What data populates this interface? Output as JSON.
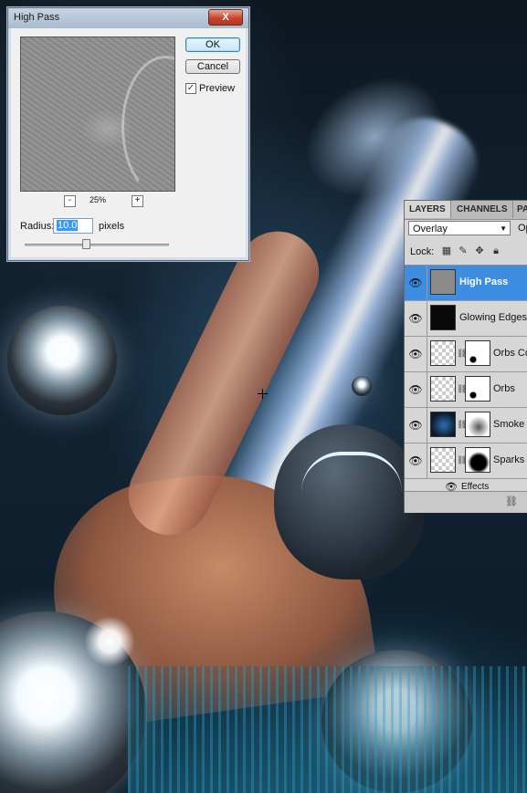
{
  "dialog": {
    "title": "High Pass",
    "close_label": "X",
    "ok_label": "OK",
    "cancel_label": "Cancel",
    "preview_label": "Preview",
    "preview_checked": true,
    "zoom_out_label": "-",
    "zoom_in_label": "+",
    "zoom_level": "25%",
    "radius_label": "Radius:",
    "radius_value": "10.0",
    "radius_unit": "pixels"
  },
  "layers_panel": {
    "tabs": [
      {
        "label": "LAYERS",
        "active": true
      },
      {
        "label": "CHANNELS",
        "active": false
      },
      {
        "label": "PA",
        "active": false
      }
    ],
    "blend_mode": "Overlay",
    "opacity_label": "Op",
    "lock_label": "Lock:",
    "lock_icons": [
      "transparency-lock-icon",
      "brush-lock-icon",
      "move-lock-icon",
      "padlock-icon"
    ],
    "layers": [
      {
        "name": "High Pass",
        "selected": true,
        "thumb": "gray",
        "mask": null
      },
      {
        "name": "Glowing Edges",
        "selected": false,
        "thumb": "black",
        "mask": null
      },
      {
        "name": "Orbs Cop",
        "selected": false,
        "thumb": "checker",
        "mask": "orbs"
      },
      {
        "name": "Orbs",
        "selected": false,
        "thumb": "checker",
        "mask": "orbs"
      },
      {
        "name": "Smoke",
        "selected": false,
        "thumb": "blue",
        "mask": "smoke"
      },
      {
        "name": "Sparks c",
        "selected": false,
        "thumb": "checker",
        "mask": "sparks"
      }
    ],
    "effects_label": "Effects"
  },
  "colors": {
    "selected_layer": "#3d8ee2",
    "close_button": "#c8452f",
    "text_selection": "#3399ff"
  }
}
